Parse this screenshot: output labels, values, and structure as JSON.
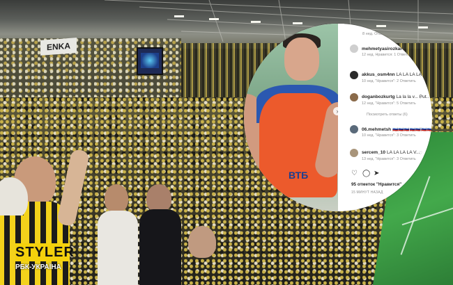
{
  "background": {
    "stadium_sign": "ENKA",
    "description_colors": {
      "crowd_yellow": "#f3d21b",
      "pitch_green": "#43a94b"
    }
  },
  "post": {
    "photo_logo": "ВТБ",
    "top_meta": "8 нед.   Ответ.",
    "comments": [
      {
        "user": "mehmetyasirozkar",
        "text": "🇷🇺🇷🇺🇷🇺🇷🇺🇷🇺",
        "meta": "12 нед.   Нравится: 1   Ответить"
      },
      {
        "user": "akkus_osm4nn",
        "text": "LA LA LA LA V..",
        "meta": "10 нед.   \"Нравится\": 2   Ответить"
      },
      {
        "user": "doganbozkurtg",
        "text": "La la la v... Put..",
        "meta": "12 нед.   \"Нравится\": 5   Ответить"
      },
      {
        "user": "06.mehmetsh",
        "text": "🇷🇺🇷🇺🇷🇺🇷🇺🇷🇺🇷🇺🇷🇺",
        "meta": "10 нед.   \"Нравится\": 3   Ответить"
      },
      {
        "user": "sercem_10",
        "text": "LA LA LA LA V...",
        "meta": "13 нед.   \"Нравится\": 3   Ответить"
      }
    ],
    "view_replies": "Посмотреть ответы (6)",
    "likes": "95 отметок \"Нравится\"",
    "time_ago": "15 МИНУТ НАЗАД"
  },
  "badge": {
    "brand": "STYLER",
    "sub": "РБК-УКРАЇНА"
  },
  "icons": [
    "heart-icon",
    "comment-icon",
    "share-icon",
    "bookmark-icon"
  ]
}
